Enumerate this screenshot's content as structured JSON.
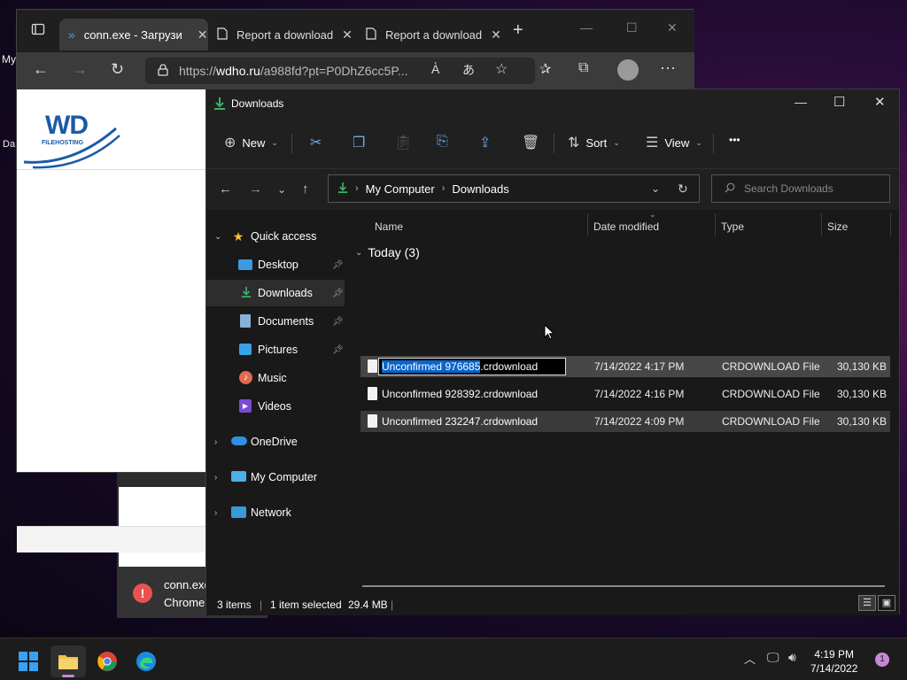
{
  "desktop": {
    "label1": "My",
    "label2": "Da"
  },
  "chrome_dialog": {
    "line1": "conn.exe",
    "line2": "Chrome",
    "error_glyph": "!"
  },
  "edge": {
    "tabs": [
      {
        "label": "conn.exe - Загрузи",
        "active": true
      },
      {
        "label": "Report a download",
        "active": false
      },
      {
        "label": "Report a download",
        "active": false
      }
    ],
    "new_tab": "+",
    "url_prefix": "https://",
    "url_host": "wdho.ru",
    "url_rest": "/a988fd?pt=P0DhZ6cc5P...",
    "logo_text": "WD",
    "logo_sub": "FILEHOSTING"
  },
  "explorer": {
    "title": "Downloads",
    "toolbar": {
      "new": "New",
      "sort": "Sort",
      "view": "View",
      "more": "•••"
    },
    "breadcrumb": [
      "My Computer",
      "Downloads"
    ],
    "search_placeholder": "Search Downloads",
    "sidebar": [
      {
        "label": "Quick access",
        "icon": "star-icon"
      },
      {
        "label": "Desktop",
        "icon": "desktop-icon"
      },
      {
        "label": "Downloads",
        "icon": "download-icon"
      },
      {
        "label": "Documents",
        "icon": "document-icon"
      },
      {
        "label": "Pictures",
        "icon": "picture-icon"
      },
      {
        "label": "Music",
        "icon": "music-icon"
      },
      {
        "label": "Videos",
        "icon": "video-icon"
      },
      {
        "label": "OneDrive",
        "icon": "cloud-icon"
      },
      {
        "label": "My Computer",
        "icon": "computer-icon"
      },
      {
        "label": "Network",
        "icon": "network-icon"
      }
    ],
    "columns": {
      "name": "Name",
      "date": "Date modified",
      "type": "Type",
      "size": "Size"
    },
    "group": "Today (3)",
    "files": [
      {
        "name": "Unconfirmed 976685.crdownload",
        "rename_selected": "Unconfirmed 976685",
        "rename_rest": ".crdownload",
        "date": "7/14/2022 4:17 PM",
        "type": "CRDOWNLOAD File",
        "size": "30,130 KB"
      },
      {
        "name": "Unconfirmed 928392.crdownload",
        "date": "7/14/2022 4:16 PM",
        "type": "CRDOWNLOAD File",
        "size": "30,130 KB"
      },
      {
        "name": "Unconfirmed 232247.crdownload",
        "date": "7/14/2022 4:09 PM",
        "type": "CRDOWNLOAD File",
        "size": "30,130 KB"
      }
    ],
    "status": {
      "items": "3 items",
      "selected": "1 item selected",
      "size": "29.4 MB"
    }
  },
  "taskbar": {
    "time": "4:19 PM",
    "date": "7/14/2022",
    "notifications": "1"
  },
  "colors": {
    "accent_download": "#3bb06a",
    "selection_highlight": "#0a64c8",
    "notification": "#c789d6"
  }
}
